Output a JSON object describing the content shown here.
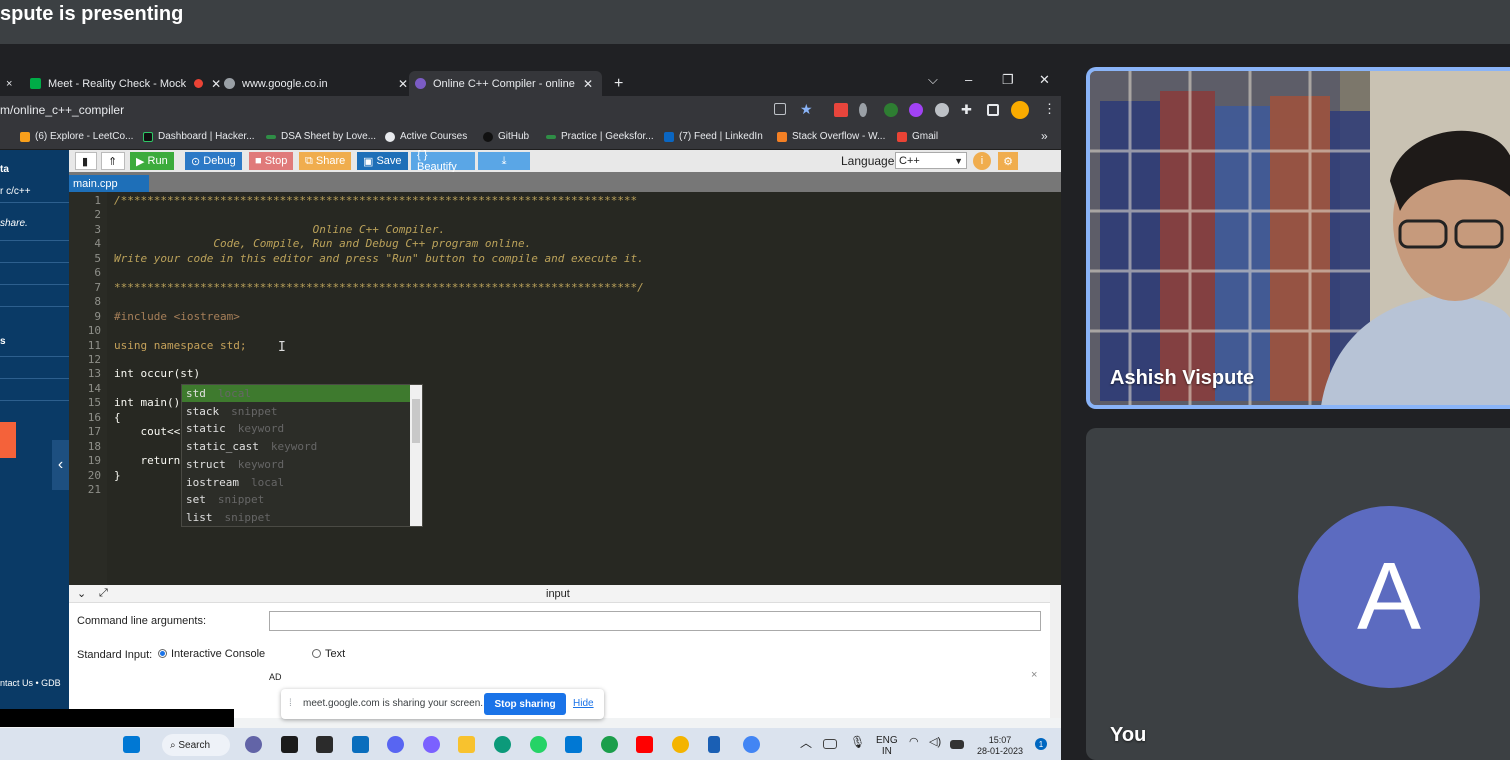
{
  "meet": {
    "presenter_title": "spute is presenting",
    "participants": [
      {
        "name": "Ashish Vispute"
      },
      {
        "name": "You",
        "avatar_letter": "A"
      }
    ]
  },
  "browser": {
    "tabs": [
      {
        "label": "×"
      },
      {
        "label": "Meet - Reality Check - Mock"
      },
      {
        "label": "www.google.co.in"
      },
      {
        "label": "Online C++ Compiler - online ec",
        "active": true
      }
    ],
    "new_tab": "+",
    "window_controls": [
      "⌵",
      "–",
      "❐",
      "✕"
    ],
    "url": "m/online_c++_compiler",
    "bookmarks": [
      "(6) Explore - LeetCo...",
      "Dashboard | Hacker...",
      "DSA Sheet by Love...",
      "Active Courses",
      "GitHub",
      "Practice | Geeksfor...",
      "(7) Feed | LinkedIn",
      "Stack Overflow - W...",
      "Gmail"
    ],
    "bookmarks_more": "»"
  },
  "sidebar": {
    "items": [
      "ta",
      "r c/c++",
      "share.",
      "s"
    ],
    "footer": "ntact Us • GDB"
  },
  "toolbar": {
    "buttons": [
      "Run",
      "Debug",
      "Stop",
      "Share",
      "Save",
      "{ } Beautify"
    ],
    "language_label": "Language",
    "language_value": "C++"
  },
  "file_tab": "main.cpp",
  "editor": {
    "lines": [
      {
        "n": "1",
        "text": "/******************************************************************************"
      },
      {
        "n": "2",
        "text": ""
      },
      {
        "n": "3",
        "text": "                              Online C++ Compiler."
      },
      {
        "n": "4",
        "text": "               Code, Compile, Run and Debug C++ program online."
      },
      {
        "n": "5",
        "text": "Write your code in this editor and press \"Run\" button to compile and execute it."
      },
      {
        "n": "6",
        "text": ""
      },
      {
        "n": "7",
        "text": "*******************************************************************************/"
      },
      {
        "n": "8",
        "text": ""
      },
      {
        "n": "9",
        "text": "#include <iostream>"
      },
      {
        "n": "10",
        "text": ""
      },
      {
        "n": "11",
        "text": "using namespace std;"
      },
      {
        "n": "12",
        "text": ""
      },
      {
        "n": "13",
        "text": "int occur(st)"
      },
      {
        "n": "14",
        "text": ""
      },
      {
        "n": "15",
        "text": "int main()"
      },
      {
        "n": "16",
        "text": "{"
      },
      {
        "n": "17",
        "text": "    cout<<"
      },
      {
        "n": "18",
        "text": ""
      },
      {
        "n": "19",
        "text": "    return"
      },
      {
        "n": "20",
        "text": "}"
      },
      {
        "n": "21",
        "text": ""
      }
    ],
    "autocomplete": [
      {
        "word": "std",
        "meta": "local"
      },
      {
        "word": "stack",
        "meta": "snippet"
      },
      {
        "word": "static",
        "meta": "keyword"
      },
      {
        "word": "static_cast",
        "meta": "keyword"
      },
      {
        "word": "struct",
        "meta": "keyword"
      },
      {
        "word": "iostream",
        "meta": "local"
      },
      {
        "word": "set",
        "meta": "snippet"
      },
      {
        "word": "list",
        "meta": "snippet"
      }
    ]
  },
  "io": {
    "header": "input",
    "cmd_label": "Command line arguments:",
    "std_input_label": "Standard Input:",
    "option_console": "Interactive Console",
    "option_text": "Text",
    "ad": "AD",
    "ad_close": "×"
  },
  "share_banner": {
    "message": "meet.google.com is sharing your screen.",
    "stop": "Stop sharing",
    "hide": "Hide"
  },
  "taskbar": {
    "search": "Search",
    "lang_top": "ENG",
    "lang_bottom": "IN",
    "time": "15:07",
    "date": "28-01-2023",
    "notif_count": "1"
  },
  "colors": {
    "run": "#3cab3c",
    "debug": "#2c79c6",
    "stop": "#e07a7a",
    "share": "#f0ad4e",
    "save": "#1e6fb8",
    "beautify": "#5aa6e6"
  }
}
